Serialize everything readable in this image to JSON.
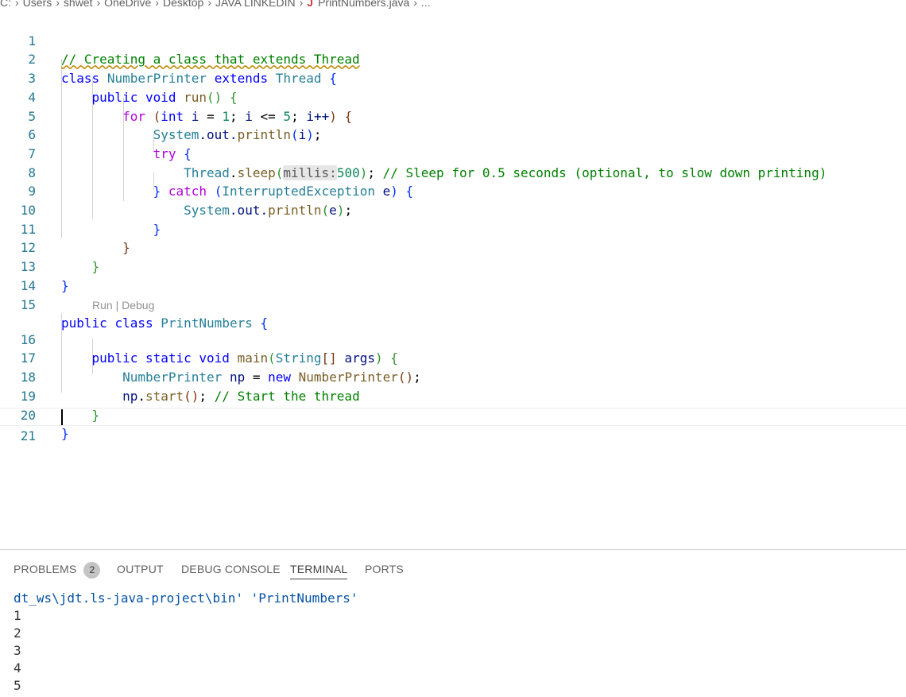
{
  "breadcrumb": {
    "items": [
      "C:",
      "Users",
      "shwet",
      "OneDrive",
      "Desktop",
      "JAVA LINKEDIN",
      "PrintNumbers.java",
      "..."
    ],
    "file_icon": "java-file-icon"
  },
  "editor": {
    "line_numbers": [
      "1",
      "2",
      "3",
      "4",
      "5",
      "6",
      "7",
      "8",
      "9",
      "10",
      "11",
      "12",
      "13",
      "14",
      "15",
      "16",
      "17",
      "18",
      "19",
      "20",
      "21"
    ],
    "codelens": "Run | Debug",
    "tokens": {
      "l1_comment": "// Creating a class that extends Thread",
      "l2_class": "class",
      "l2_name": "NumberPrinter",
      "l2_extends": "extends",
      "l2_thread": "Thread",
      "l2_brace": "{",
      "l3_public": "public",
      "l3_void": "void",
      "l3_run": "run",
      "l3_parens": "()",
      "l3_brace": "{",
      "l4_for": "for",
      "l4_open": "(",
      "l4_int": "int",
      "l4_i": "i",
      "l4_eq": " = ",
      "l4_1": "1",
      "l4_semi1": "; ",
      "l4_i2": "i",
      "l4_le": " <= ",
      "l4_5": "5",
      "l4_semi2": "; ",
      "l4_inc": "i++",
      "l4_close": ")",
      "l4_brace": "{",
      "l5_system": "System",
      "l5_out": ".out.",
      "l5_println": "println",
      "l5_open": "(",
      "l5_i": "i",
      "l5_close": ")",
      "l5_semi": ";",
      "l6_try": "try",
      "l6_brace": "{",
      "l7_thread": "Thread",
      "l7_dot": ".",
      "l7_sleep": "sleep",
      "l7_open": "(",
      "l7_hint": "millis:",
      "l7_500": "500",
      "l7_close": ")",
      "l7_semi": "; ",
      "l7_comment": "// Sleep for 0.5 seconds (optional, to slow down printing)",
      "l8_rbrace": "}",
      "l8_catch": "catch",
      "l8_open": "(",
      "l8_ex": "InterruptedException",
      "l8_e": "e",
      "l8_close": ")",
      "l8_brace": "{",
      "l9_system": "System",
      "l9_out": ".out.",
      "l9_println": "println",
      "l9_open": "(",
      "l9_e": "e",
      "l9_close": ")",
      "l9_semi": ";",
      "l10_brace": "}",
      "l11_brace": "}",
      "l12_brace": "}",
      "l13_brace": "}",
      "l15_public": "public",
      "l15_class": "class",
      "l15_name": "PrintNumbers",
      "l15_brace": "{",
      "l16_public": "public",
      "l16_static": "static",
      "l16_void": "void",
      "l16_main": "main",
      "l16_open": "(",
      "l16_string": "String",
      "l16_arr": "[]",
      "l16_args": "args",
      "l16_close": ")",
      "l16_brace": "{",
      "l17_type": "NumberPrinter",
      "l17_np": "np",
      "l17_eq": " = ",
      "l17_new": "new",
      "l17_ctor": "NumberPrinter",
      "l17_parens": "()",
      "l17_semi": ";",
      "l18_np": "np",
      "l18_dot": ".",
      "l18_start": "start",
      "l18_parens": "()",
      "l18_semi": "; ",
      "l18_comment": "// Start the thread",
      "l19_brace": "}",
      "l20_brace": "}"
    }
  },
  "panel": {
    "tabs": [
      {
        "label": "PROBLEMS",
        "badge": "2"
      },
      {
        "label": "OUTPUT"
      },
      {
        "label": "DEBUG CONSOLE"
      },
      {
        "label": "TERMINAL"
      },
      {
        "label": "PORTS"
      }
    ],
    "active_tab": "TERMINAL",
    "terminal_lines": [
      "dt_ws\\jdt.ls-java-project\\bin' 'PrintNumbers'",
      "1",
      "2",
      "3",
      "4",
      "5"
    ]
  }
}
